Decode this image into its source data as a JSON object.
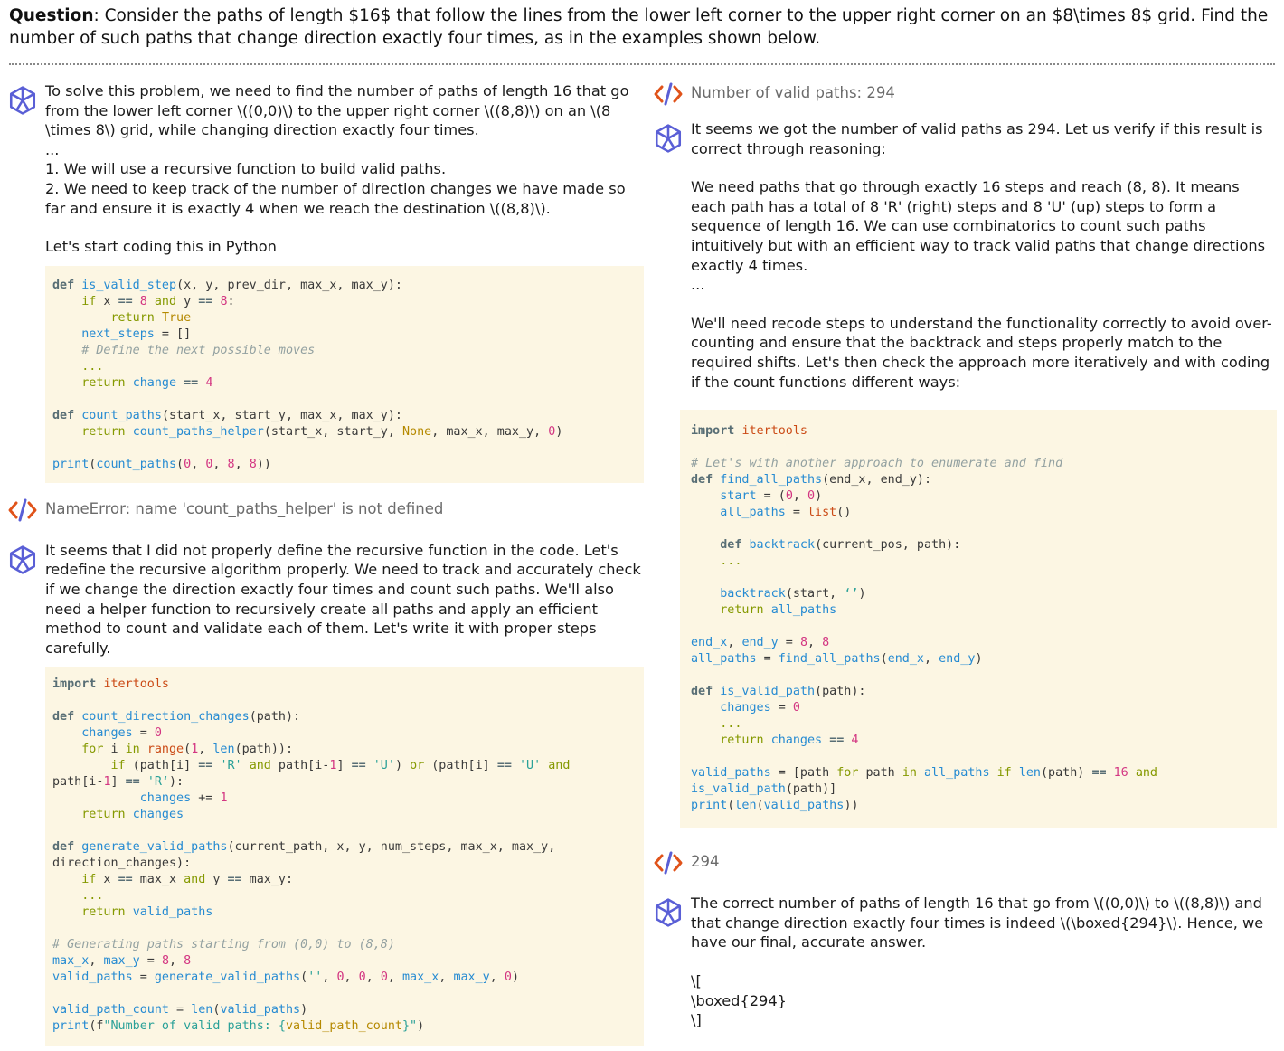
{
  "question": {
    "label": "Question",
    "text": ": Consider the paths of length $16$ that follow the lines from the lower left corner to the upper right corner on an $8\\times 8$ grid. Find the number of such paths that change direction exactly four times, as in the examples shown below."
  },
  "left": {
    "msg1": {
      "p1": "To solve this problem, we need to find the number of paths of length 16 that go from the lower left corner \\((0,0)\\) to the upper right corner \\((8,8)\\) on an \\(8 \\times 8\\) grid, while changing direction exactly four times.",
      "p2": "...",
      "p3": "1. We will use a recursive function to build valid paths.",
      "p4": "2. We need to keep track of the number of direction changes we have made so far and ensure it is exactly 4 when we reach the destination \\((8,8)\\).",
      "p5": "Let's start coding this in Python"
    },
    "output1": "NameError: name 'count_paths_helper' is not defined",
    "msg2": {
      "p1": "It seems that I did not properly define the recursive function in the code. Let's redefine the recursive algorithm properly. We need to track and accurately check if we change the direction exactly four times and count such paths. We'll also need a helper function to recursively create all paths and apply an efficient method to count and validate each of them. Let's write it with proper steps carefully."
    }
  },
  "right": {
    "output1": "Number of valid paths: 294",
    "msg1": {
      "p1": "It seems we got the number of valid paths as 294. Let us verify if this result is correct through reasoning:",
      "p2": "We need paths that go through exactly 16 steps and reach (8, 8). It means each path has a total of 8 'R' (right) steps and 8 'U' (up) steps to form a sequence of length 16. We can use combinatorics to count such paths intuitively but with an efficient way to track valid paths that change directions exactly 4 times.",
      "p3": "...",
      "p4": "We'll need recode steps to understand the functionality correctly to avoid over-counting and ensure that the backtrack and steps properly match to the required shifts. Let's then check the approach more iteratively and with coding if the count functions different ways:"
    },
    "output2": "294",
    "msg2": {
      "p1": "The correct number of paths of length 16 that go from \\((0,0)\\) to \\((8,8)\\) and that change direction exactly four times is indeed \\(\\boxed{294}\\). Hence, we have our final, accurate answer.",
      "p2": "\\[",
      "p3": "\\boxed{294}",
      "p4": "\\]"
    }
  }
}
